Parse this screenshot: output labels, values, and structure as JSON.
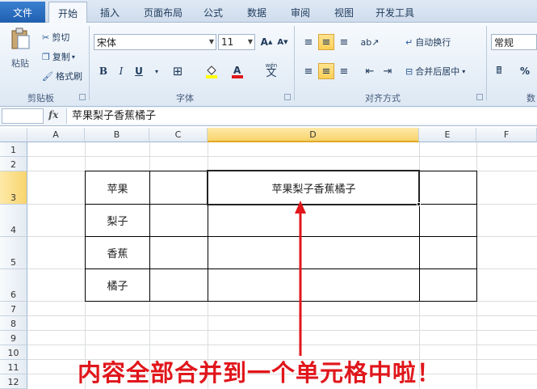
{
  "tabs": [
    {
      "label": "文件"
    },
    {
      "label": "开始"
    },
    {
      "label": "插入"
    },
    {
      "label": "页面布局"
    },
    {
      "label": "公式"
    },
    {
      "label": "数据"
    },
    {
      "label": "审阅"
    },
    {
      "label": "视图"
    },
    {
      "label": "开发工具"
    }
  ],
  "ribbon": {
    "clipboard": {
      "paste": "粘贴",
      "cut": "剪切",
      "copy": "复制",
      "format_painter": "格式刷",
      "label": "剪贴板"
    },
    "font": {
      "name": "宋体",
      "size": "11",
      "label": "字体",
      "bold": "B",
      "italic": "I",
      "underline": "U"
    },
    "alignment": {
      "wrap": "自动换行",
      "merge": "合并后居中",
      "label": "对齐方式"
    },
    "number": {
      "format": "常规",
      "label": "数"
    }
  },
  "formula_bar": {
    "fx": "fx",
    "value": "苹果梨子香蕉橘子"
  },
  "columns": [
    "A",
    "B",
    "C",
    "D",
    "E",
    "F"
  ],
  "rows": [
    "1",
    "2",
    "3",
    "4",
    "5",
    "6",
    "7",
    "8",
    "9",
    "10",
    "11",
    "12"
  ],
  "cells": {
    "B3": "苹果",
    "B4": "梨子",
    "B5": "香蕉",
    "B6": "橘子",
    "D3": "苹果梨子香蕉橘子"
  },
  "annotation": "内容全部合并到一个单元格中啦！",
  "colors": {
    "accent": "#1f5fb0",
    "annotation": "#e0161b",
    "selected_header": "#f9d46d"
  }
}
